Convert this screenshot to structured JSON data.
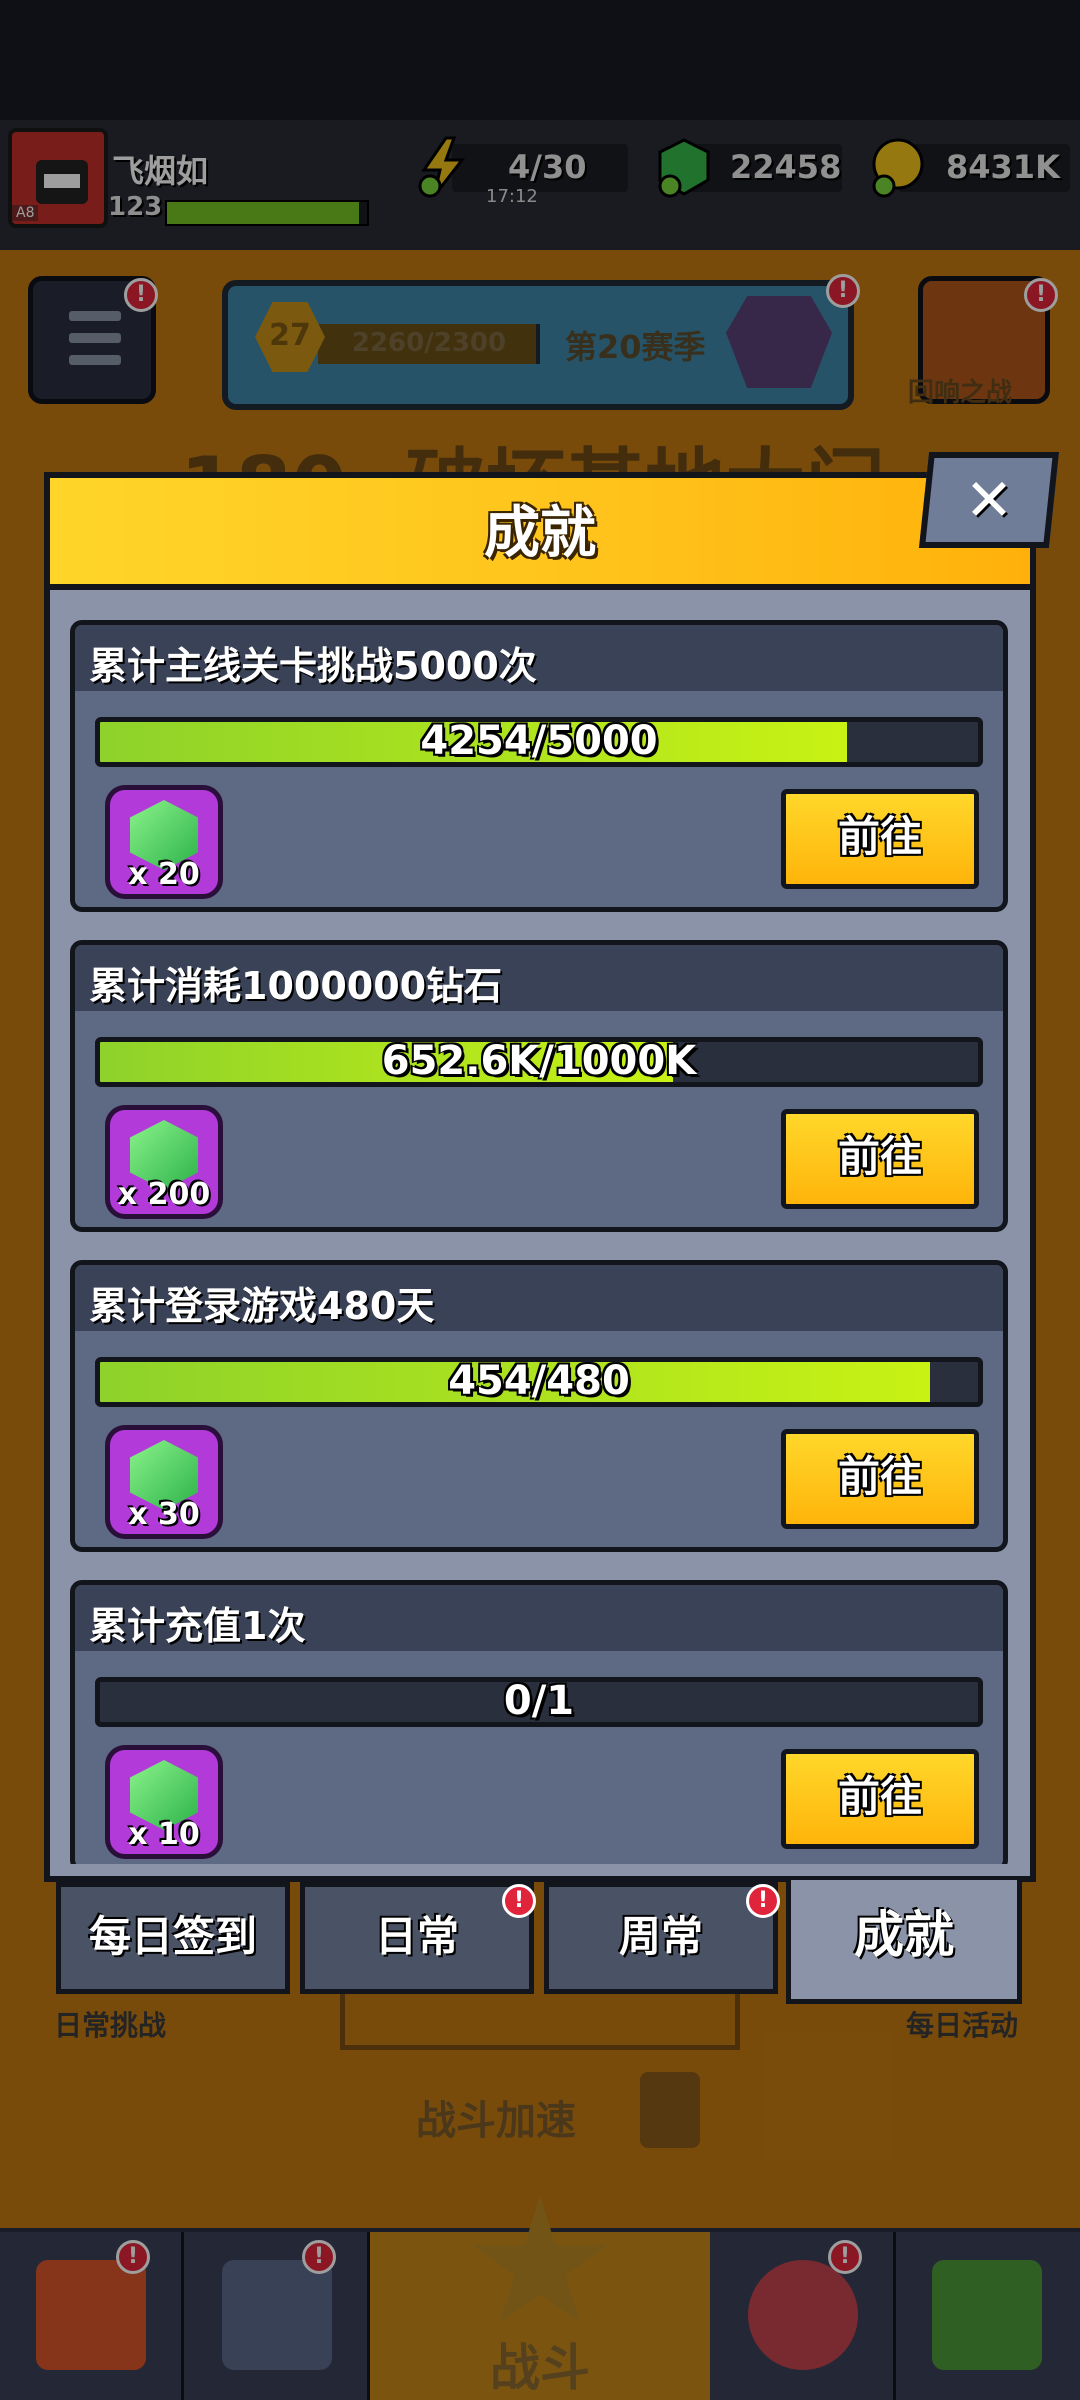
{
  "player": {
    "name": "飞烟如",
    "level": "123",
    "avatar_tag": "A8"
  },
  "resources": {
    "energy": "4/30",
    "energy_timer": "17:12",
    "gems": "22458",
    "coins": "8431K"
  },
  "season": {
    "level": "27",
    "progress": "2260/2300",
    "label": "第20赛季"
  },
  "background": {
    "stage_title": "180. 破坏基地大门",
    "echo_label": "回响之战",
    "daily_challenge_label": "日常挑战",
    "daily_activity_label": "每日活动",
    "battle_speed_label": "战斗加速",
    "battle_label": "战斗"
  },
  "modal": {
    "title": "成就",
    "close_symbol": "✕",
    "achievements": [
      {
        "title": "累计主线关卡挑战5000次",
        "progress_text": "4254/5000",
        "progress": 0.8508,
        "reward_qty": "x 20",
        "button": "前往"
      },
      {
        "title": "累计消耗1000000钻石",
        "progress_text": "652.6K/1000K",
        "progress": 0.6526,
        "reward_qty": "x 200",
        "button": "前往"
      },
      {
        "title": "累计登录游戏480天",
        "progress_text": "454/480",
        "progress": 0.9458,
        "reward_qty": "x 30",
        "button": "前往"
      },
      {
        "title": "累计充值1次",
        "progress_text": "0/1",
        "progress": 0,
        "reward_qty": "x 10",
        "button": "前往"
      }
    ]
  },
  "tabs": [
    {
      "label": "每日签到",
      "alert": false
    },
    {
      "label": "日常",
      "alert": true
    },
    {
      "label": "周常",
      "alert": true
    },
    {
      "label": "成就",
      "alert": false,
      "active": true
    }
  ],
  "alert_symbol": "!",
  "colors": {
    "accent": "#ffc21a",
    "progress": "#b4e81c",
    "panel": "#5e6984",
    "alert": "#e0243b"
  }
}
